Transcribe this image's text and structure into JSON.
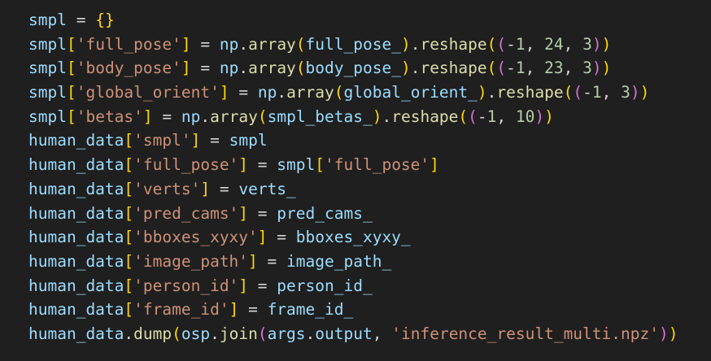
{
  "editor": {
    "theme_colors": {
      "background": "#1f1f1f",
      "variable": "#9cdcfe",
      "operator": "#d4d4d4",
      "string": "#ce9178",
      "number": "#b5cea8",
      "function": "#dcdcaa",
      "bracket_level_1": "#ffd700",
      "bracket_level_2": "#da70d6",
      "bracket_level_3": "#179fff"
    },
    "lines": [
      "smpl = {}",
      "smpl['full_pose'] = np.array(full_pose_).reshape((-1, 24, 3))",
      "smpl['body_pose'] = np.array(body_pose_).reshape((-1, 23, 3))",
      "smpl['global_orient'] = np.array(global_orient_).reshape((-1, 3))",
      "smpl['betas'] = np.array(smpl_betas_).reshape((-1, 10))",
      "human_data['smpl'] = smpl",
      "human_data['full_pose'] = smpl['full_pose']",
      "human_data['verts'] = verts_",
      "human_data['pred_cams'] = pred_cams_",
      "human_data['bboxes_xyxy'] = bboxes_xyxy_",
      "human_data['image_path'] = image_path_",
      "human_data['person_id'] = person_id_",
      "human_data['frame_id'] = frame_id_",
      "human_data.dump(osp.join(args.output, 'inference_result_multi.npz'))"
    ]
  }
}
